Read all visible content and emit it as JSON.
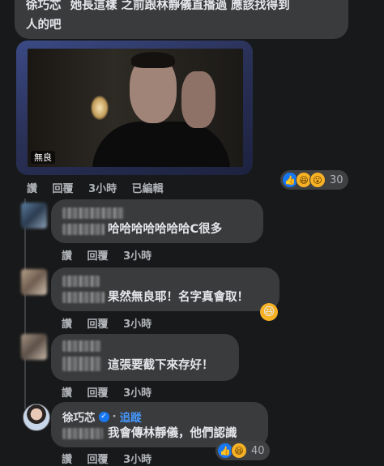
{
  "main_comment": {
    "author": "徐巧芯",
    "text_line1": "她長這樣 之前跟林靜儀直播過 應該找得到",
    "text_line2": "人的吧",
    "image_label": "無良",
    "actions": {
      "like": "讚",
      "reply": "回覆",
      "time": "3小時",
      "edited": "已編輯"
    },
    "reaction_count": "30"
  },
  "replies": [
    {
      "text": "哈哈哈哈哈哈哈C很多",
      "actions": {
        "like": "讚",
        "reply": "回覆",
        "time": "3小時"
      }
    },
    {
      "text": "果然無良耶！名字真會取！",
      "actions": {
        "like": "讚",
        "reply": "回覆",
        "time": "3小時"
      }
    },
    {
      "text": "這張要截下來存好！",
      "actions": {
        "like": "讚",
        "reply": "回覆",
        "time": "3小時"
      }
    },
    {
      "author": "徐巧芯",
      "follow": "追蹤",
      "text": "我會傳林靜儀，他們認識",
      "actions": {
        "like": "讚",
        "reply": "回覆",
        "time": "3小時"
      },
      "reaction_count": "40"
    }
  ],
  "colors": {
    "background": "#18191a",
    "bubble": "#3a3b3c",
    "text": "#e4e6eb",
    "muted": "#b0b3b8",
    "link": "#4599ff",
    "like_blue": "#1877f2",
    "emoji_yellow": "#f7b125"
  },
  "icons": [
    "like-icon",
    "haha-icon",
    "wow-icon",
    "verified-badge-icon"
  ]
}
